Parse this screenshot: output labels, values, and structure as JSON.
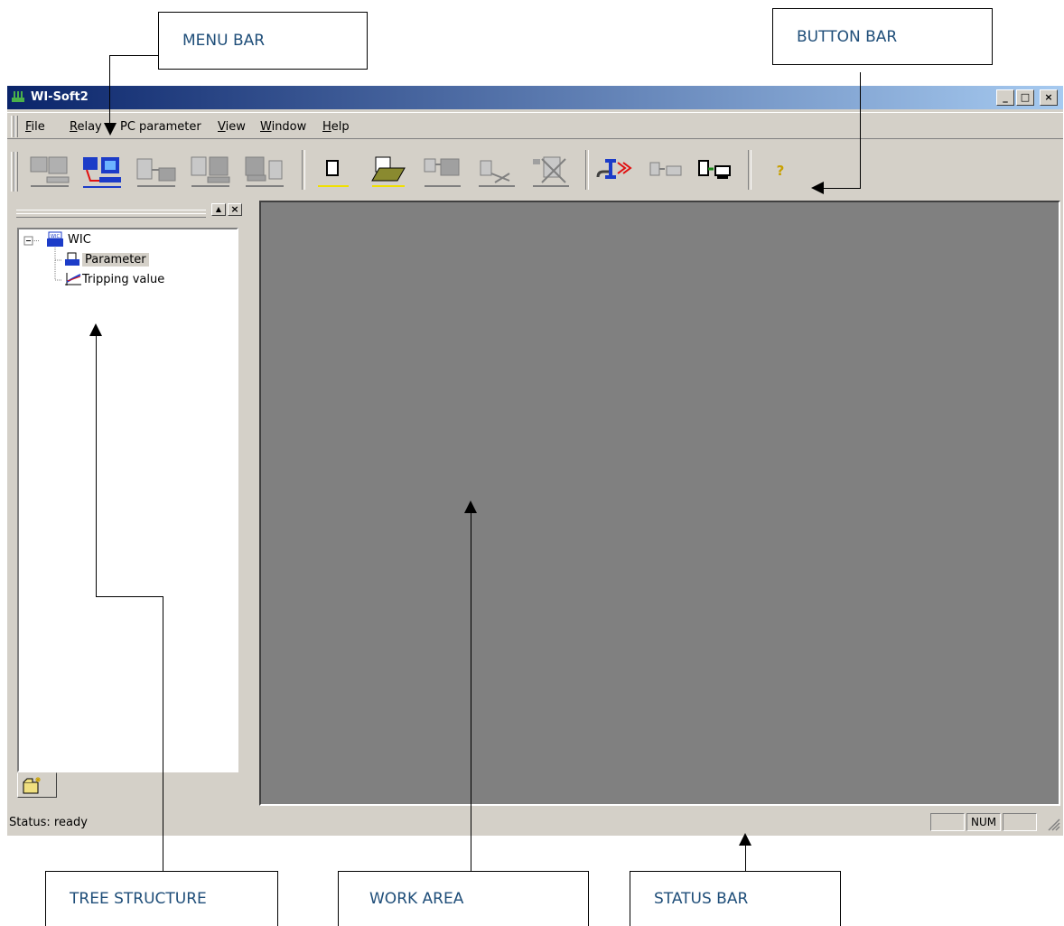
{
  "callouts": {
    "menu_bar": "MENU BAR",
    "button_bar": "BUTTON BAR",
    "tree_structure": "TREE STRUCTURE",
    "work_area": "WORK AREA",
    "status_bar": "STATUS BAR"
  },
  "window": {
    "title": "WI-Soft2",
    "controls": [
      "_",
      "□",
      "×"
    ]
  },
  "menu": {
    "items": [
      {
        "underline": "F",
        "rest": "ile"
      },
      {
        "underline": "R",
        "rest": "elay"
      },
      {
        "underline": "",
        "rest": "PC parameter"
      },
      {
        "underline": "V",
        "rest": "iew"
      },
      {
        "underline": "W",
        "rest": "indow"
      },
      {
        "underline": "H",
        "rest": "elp"
      }
    ]
  },
  "toolbar": {
    "icons": [
      "read-from-relay-icon",
      "connect-relay-icon",
      "send-to-relay-icon",
      "compare-relay-icon",
      "relay-data-icon",
      "new-file-icon",
      "open-file-icon",
      "save-file-icon",
      "cut-icon",
      "delete-icon",
      "tools-icon",
      "print-preview-icon",
      "print-icon",
      "help-icon"
    ],
    "help_glyph": "?"
  },
  "tree": {
    "root": "WIC",
    "root_icon_label": "WIC",
    "children": [
      "Parameter",
      "Tripping value"
    ]
  },
  "status": {
    "text": "Status: ready",
    "num_indicator": "NUM"
  },
  "colors": {
    "title_gradient_start": "#0a246a",
    "title_gradient_end": "#a6caf0",
    "chrome": "#d4d0c8",
    "work_area": "#808080",
    "callout_text": "#1f4e79"
  }
}
